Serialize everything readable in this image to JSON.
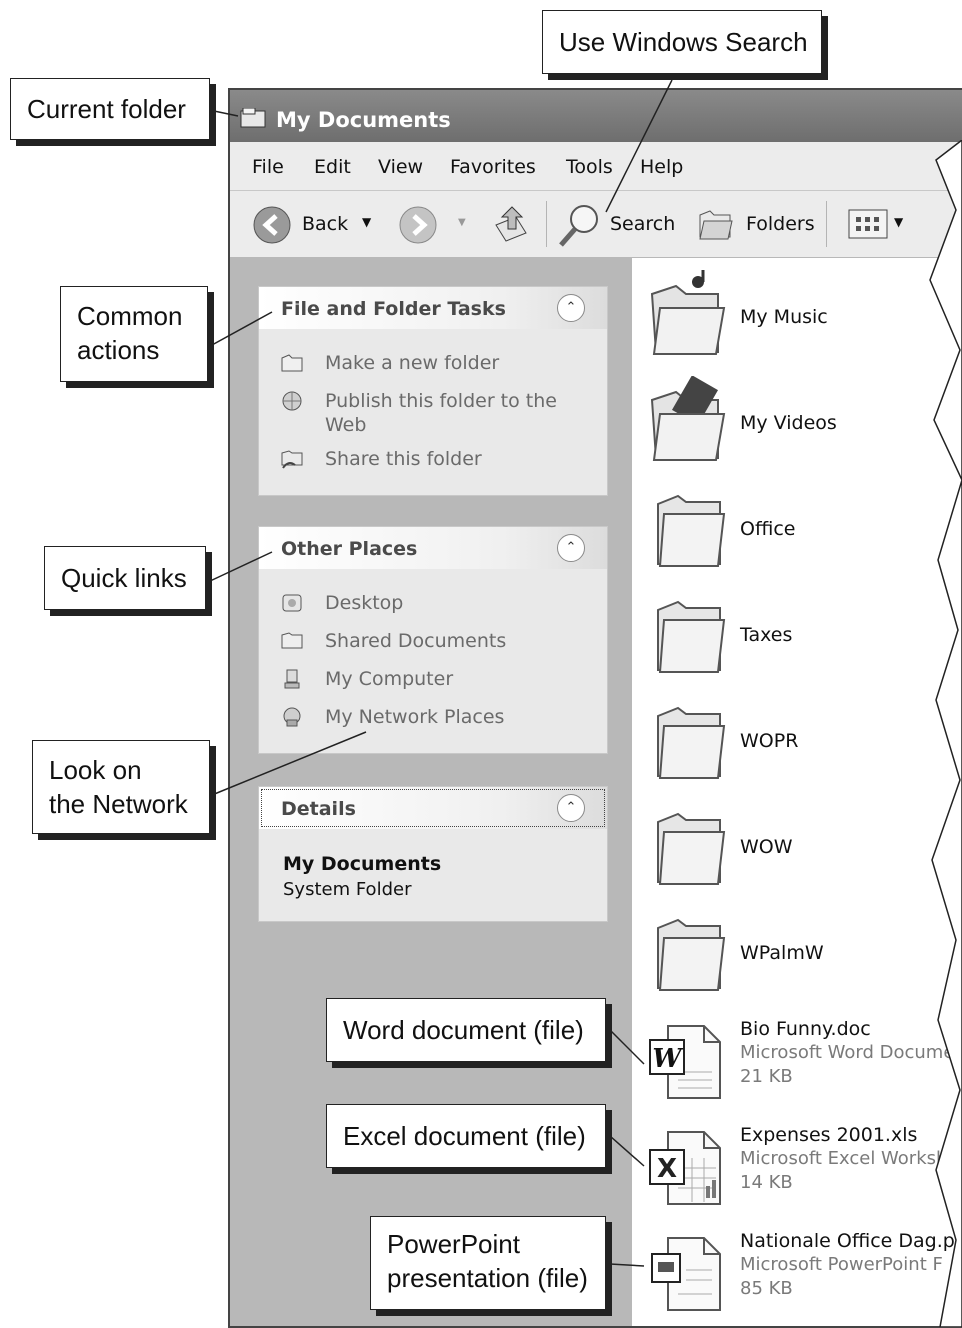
{
  "window": {
    "title": "My Documents",
    "menu": [
      "File",
      "Edit",
      "View",
      "Favorites",
      "Tools",
      "Help"
    ],
    "toolbar": {
      "back": "Back",
      "search": "Search",
      "folders": "Folders"
    }
  },
  "left_pane": {
    "file_tasks": {
      "title": "File and Folder Tasks",
      "items": [
        "Make a new folder",
        "Publish this folder to the Web",
        "Share this folder"
      ]
    },
    "other_places": {
      "title": "Other Places",
      "items": [
        "Desktop",
        "Shared Documents",
        "My Computer",
        "My Network Places"
      ]
    },
    "details": {
      "title": "Details",
      "name": "My Documents",
      "type": "System Folder"
    }
  },
  "files": [
    {
      "name": "My Music",
      "icon": "music-folder-icon"
    },
    {
      "name": "My Videos",
      "icon": "video-folder-icon"
    },
    {
      "name": "Office",
      "icon": "folder-icon"
    },
    {
      "name": "Taxes",
      "icon": "folder-icon"
    },
    {
      "name": "WOPR",
      "icon": "folder-icon"
    },
    {
      "name": "WOW",
      "icon": "folder-icon"
    },
    {
      "name": "WPalmW",
      "icon": "folder-icon"
    },
    {
      "name": "Bio Funny.doc",
      "type": "Microsoft Word Documer",
      "size": "21 KB",
      "icon": "word-doc-icon"
    },
    {
      "name": "Expenses 2001.xls",
      "type": "Microsoft Excel Workshe",
      "size": "14 KB",
      "icon": "excel-doc-icon"
    },
    {
      "name": "Nationale Office Dag.pr",
      "type": "Microsoft PowerPoint F",
      "size": "85 KB",
      "icon": "powerpoint-doc-icon"
    }
  ],
  "callouts": {
    "current_folder": "Current folder",
    "search": "Use Windows Search",
    "common_actions": [
      "Common",
      "actions"
    ],
    "quick_links": "Quick links",
    "network": [
      "Look on",
      "the Network"
    ],
    "word": "Word document (file)",
    "excel": "Excel document (file)",
    "powerpoint": [
      "PowerPoint",
      "presentation (file)"
    ]
  }
}
